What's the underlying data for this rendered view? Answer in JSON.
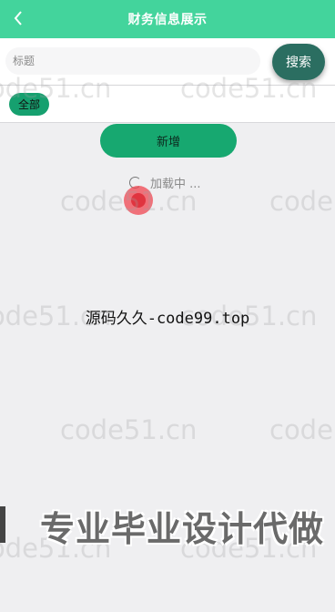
{
  "header": {
    "title": "财务信息展示",
    "back_icon": "chevron-left-icon"
  },
  "search": {
    "placeholder": "标题",
    "value": "",
    "button_label": "搜索"
  },
  "filter": {
    "chips": [
      {
        "label": "全部",
        "selected": true
      }
    ]
  },
  "actions": {
    "add_label": "新增"
  },
  "status": {
    "loading_text": "加载中 ..."
  },
  "overlay": {
    "watermark_text": "code51.cn",
    "center_text": "源码久久-code99.top",
    "banner_text": "专业毕业设计代做"
  },
  "colors": {
    "header_bg": "#43d49c",
    "search_button_bg": "#2b6e61",
    "chip_bg": "#16a06f",
    "add_button_bg": "#17a870",
    "touch_indicator": "#e0343f"
  }
}
